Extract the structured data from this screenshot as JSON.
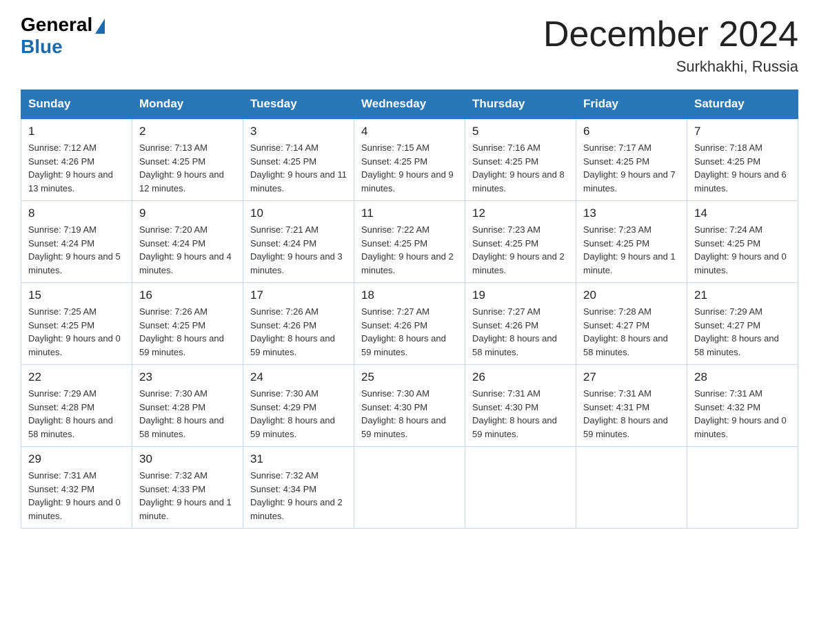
{
  "header": {
    "logo_general": "General",
    "logo_blue": "Blue",
    "month_title": "December 2024",
    "location": "Surkhakhi, Russia"
  },
  "days_of_week": [
    "Sunday",
    "Monday",
    "Tuesday",
    "Wednesday",
    "Thursday",
    "Friday",
    "Saturday"
  ],
  "weeks": [
    [
      {
        "day": "1",
        "sunrise": "7:12 AM",
        "sunset": "4:26 PM",
        "daylight": "9 hours and 13 minutes."
      },
      {
        "day": "2",
        "sunrise": "7:13 AM",
        "sunset": "4:25 PM",
        "daylight": "9 hours and 12 minutes."
      },
      {
        "day": "3",
        "sunrise": "7:14 AM",
        "sunset": "4:25 PM",
        "daylight": "9 hours and 11 minutes."
      },
      {
        "day": "4",
        "sunrise": "7:15 AM",
        "sunset": "4:25 PM",
        "daylight": "9 hours and 9 minutes."
      },
      {
        "day": "5",
        "sunrise": "7:16 AM",
        "sunset": "4:25 PM",
        "daylight": "9 hours and 8 minutes."
      },
      {
        "day": "6",
        "sunrise": "7:17 AM",
        "sunset": "4:25 PM",
        "daylight": "9 hours and 7 minutes."
      },
      {
        "day": "7",
        "sunrise": "7:18 AM",
        "sunset": "4:25 PM",
        "daylight": "9 hours and 6 minutes."
      }
    ],
    [
      {
        "day": "8",
        "sunrise": "7:19 AM",
        "sunset": "4:24 PM",
        "daylight": "9 hours and 5 minutes."
      },
      {
        "day": "9",
        "sunrise": "7:20 AM",
        "sunset": "4:24 PM",
        "daylight": "9 hours and 4 minutes."
      },
      {
        "day": "10",
        "sunrise": "7:21 AM",
        "sunset": "4:24 PM",
        "daylight": "9 hours and 3 minutes."
      },
      {
        "day": "11",
        "sunrise": "7:22 AM",
        "sunset": "4:25 PM",
        "daylight": "9 hours and 2 minutes."
      },
      {
        "day": "12",
        "sunrise": "7:23 AM",
        "sunset": "4:25 PM",
        "daylight": "9 hours and 2 minutes."
      },
      {
        "day": "13",
        "sunrise": "7:23 AM",
        "sunset": "4:25 PM",
        "daylight": "9 hours and 1 minute."
      },
      {
        "day": "14",
        "sunrise": "7:24 AM",
        "sunset": "4:25 PM",
        "daylight": "9 hours and 0 minutes."
      }
    ],
    [
      {
        "day": "15",
        "sunrise": "7:25 AM",
        "sunset": "4:25 PM",
        "daylight": "9 hours and 0 minutes."
      },
      {
        "day": "16",
        "sunrise": "7:26 AM",
        "sunset": "4:25 PM",
        "daylight": "8 hours and 59 minutes."
      },
      {
        "day": "17",
        "sunrise": "7:26 AM",
        "sunset": "4:26 PM",
        "daylight": "8 hours and 59 minutes."
      },
      {
        "day": "18",
        "sunrise": "7:27 AM",
        "sunset": "4:26 PM",
        "daylight": "8 hours and 59 minutes."
      },
      {
        "day": "19",
        "sunrise": "7:27 AM",
        "sunset": "4:26 PM",
        "daylight": "8 hours and 58 minutes."
      },
      {
        "day": "20",
        "sunrise": "7:28 AM",
        "sunset": "4:27 PM",
        "daylight": "8 hours and 58 minutes."
      },
      {
        "day": "21",
        "sunrise": "7:29 AM",
        "sunset": "4:27 PM",
        "daylight": "8 hours and 58 minutes."
      }
    ],
    [
      {
        "day": "22",
        "sunrise": "7:29 AM",
        "sunset": "4:28 PM",
        "daylight": "8 hours and 58 minutes."
      },
      {
        "day": "23",
        "sunrise": "7:30 AM",
        "sunset": "4:28 PM",
        "daylight": "8 hours and 58 minutes."
      },
      {
        "day": "24",
        "sunrise": "7:30 AM",
        "sunset": "4:29 PM",
        "daylight": "8 hours and 59 minutes."
      },
      {
        "day": "25",
        "sunrise": "7:30 AM",
        "sunset": "4:30 PM",
        "daylight": "8 hours and 59 minutes."
      },
      {
        "day": "26",
        "sunrise": "7:31 AM",
        "sunset": "4:30 PM",
        "daylight": "8 hours and 59 minutes."
      },
      {
        "day": "27",
        "sunrise": "7:31 AM",
        "sunset": "4:31 PM",
        "daylight": "8 hours and 59 minutes."
      },
      {
        "day": "28",
        "sunrise": "7:31 AM",
        "sunset": "4:32 PM",
        "daylight": "9 hours and 0 minutes."
      }
    ],
    [
      {
        "day": "29",
        "sunrise": "7:31 AM",
        "sunset": "4:32 PM",
        "daylight": "9 hours and 0 minutes."
      },
      {
        "day": "30",
        "sunrise": "7:32 AM",
        "sunset": "4:33 PM",
        "daylight": "9 hours and 1 minute."
      },
      {
        "day": "31",
        "sunrise": "7:32 AM",
        "sunset": "4:34 PM",
        "daylight": "9 hours and 2 minutes."
      },
      null,
      null,
      null,
      null
    ]
  ]
}
